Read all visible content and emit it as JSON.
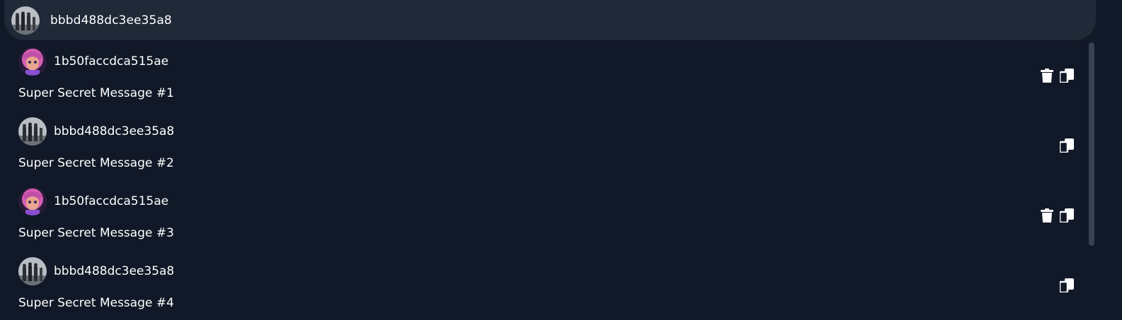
{
  "header": {
    "name": "bbbd488dc3ee35a8",
    "avatar_icon": "group-photo-avatar"
  },
  "messages": [
    {
      "author": "1b50faccdca515ae",
      "avatar_icon": "pink-character-avatar",
      "text": "Super Secret Message #1",
      "deletable": true
    },
    {
      "author": "bbbd488dc3ee35a8",
      "avatar_icon": "group-photo-avatar",
      "text": "Super Secret Message #2",
      "deletable": false
    },
    {
      "author": "1b50faccdca515ae",
      "avatar_icon": "pink-character-avatar",
      "text": "Super Secret Message #3",
      "deletable": true
    },
    {
      "author": "bbbd488dc3ee35a8",
      "avatar_icon": "group-photo-avatar",
      "text": "Super Secret Message #4",
      "deletable": false
    }
  ],
  "icons": {
    "delete": "trash-icon",
    "copy": "copy-icon"
  },
  "colors": {
    "background": "#111827",
    "header": "#1f2937",
    "text": "#ffffff",
    "scrollbar": "#374151"
  }
}
